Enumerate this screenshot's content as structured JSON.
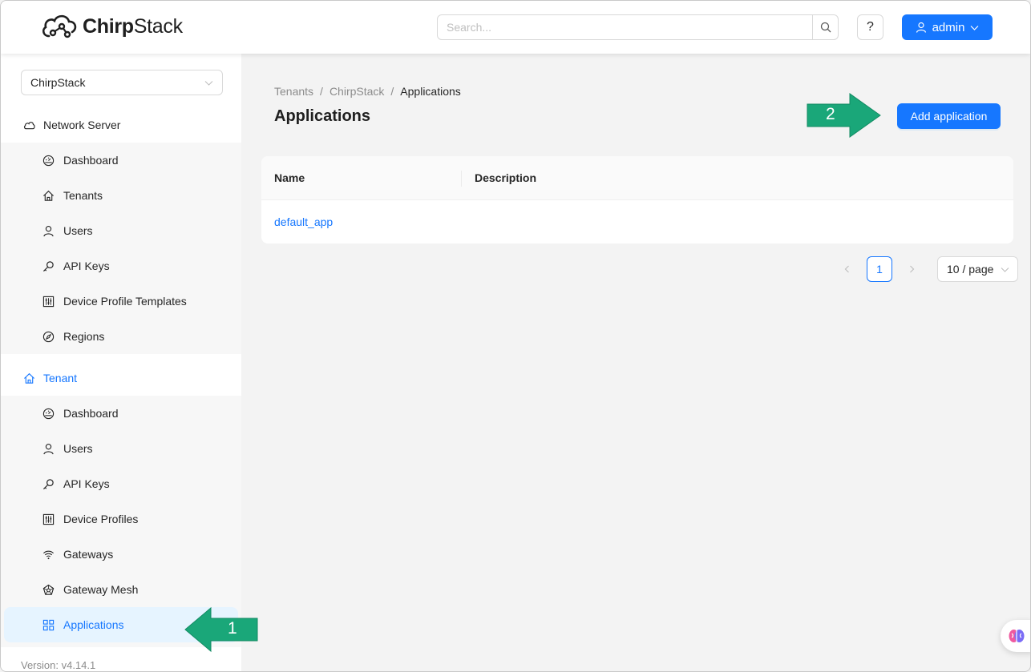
{
  "app": {
    "brand_prefix": "Chirp",
    "brand_suffix": "Stack"
  },
  "header": {
    "search_placeholder": "Search...",
    "help_label": "?",
    "user_label": "admin"
  },
  "sidebar": {
    "tenant_select_value": "ChirpStack",
    "network_server": {
      "title": "Network Server",
      "items": [
        {
          "label": "Dashboard",
          "icon": "dashboard-icon"
        },
        {
          "label": "Tenants",
          "icon": "home-icon"
        },
        {
          "label": "Users",
          "icon": "user-icon"
        },
        {
          "label": "API Keys",
          "icon": "key-icon"
        },
        {
          "label": "Device Profile Templates",
          "icon": "sliders-icon"
        },
        {
          "label": "Regions",
          "icon": "compass-icon"
        }
      ]
    },
    "tenant": {
      "title": "Tenant",
      "items": [
        {
          "label": "Dashboard",
          "icon": "dashboard-icon"
        },
        {
          "label": "Users",
          "icon": "user-icon"
        },
        {
          "label": "API Keys",
          "icon": "key-icon"
        },
        {
          "label": "Device Profiles",
          "icon": "sliders-icon"
        },
        {
          "label": "Gateways",
          "icon": "wifi-icon"
        },
        {
          "label": "Gateway Mesh",
          "icon": "mesh-icon"
        },
        {
          "label": "Applications",
          "icon": "appstore-icon"
        }
      ]
    },
    "version": "Version: v4.14.1"
  },
  "content": {
    "breadcrumb": [
      "Tenants",
      "ChirpStack",
      "Applications"
    ],
    "breadcrumb_separator": "/",
    "title": "Applications",
    "add_button": "Add application",
    "table": {
      "columns": [
        "Name",
        "Description"
      ],
      "rows": [
        {
          "name": "default_app",
          "description": ""
        }
      ]
    },
    "pagination": {
      "current_page": "1",
      "page_size": "10 / page"
    }
  },
  "annotations": [
    {
      "number": "1",
      "color": "#1aa779"
    },
    {
      "number": "2",
      "color": "#1aa779"
    }
  ],
  "colors": {
    "primary": "#1677ff",
    "annotation": "#1aa779"
  }
}
